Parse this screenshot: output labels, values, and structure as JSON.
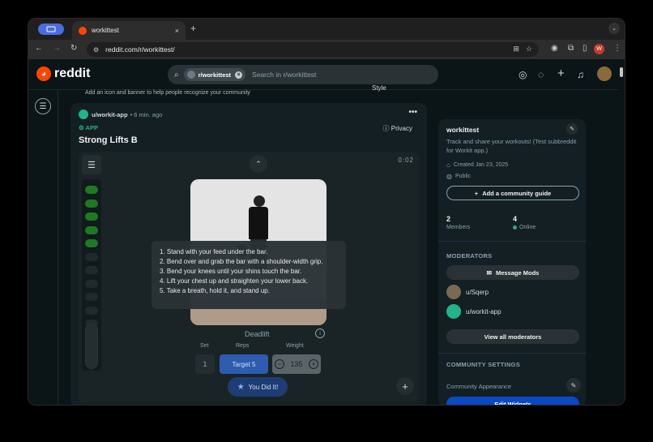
{
  "browser": {
    "tab_title": "workittest",
    "tab_close": "×",
    "new_tab": "+",
    "url": "reddit.com/r/workittest/",
    "profile_initial": "W"
  },
  "header": {
    "logo_text": "reddit",
    "search_chip": "r/workittest",
    "search_placeholder": "Search in r/workittest"
  },
  "banner_hint": "Add an icon and banner to help people recognize your community",
  "style_label": "Style",
  "post": {
    "author": "u/workit-app",
    "time": "• 6 min. ago",
    "more": "•••",
    "app_tag": "APP",
    "privacy": "Privacy",
    "title": "Strong Lifts B"
  },
  "app": {
    "timer": "0:02",
    "instructions": [
      "1. Stand with your feed under the bar.",
      "2. Bend over and grab the bar with a shoulder-width grip.",
      "3. Bend your knees until your shins touch the bar.",
      "4. Lift your chest up and straighten your lower back.",
      "5. Take a breath, hold it, and stand up."
    ],
    "exercise_name": "Deadlift",
    "labels": {
      "set": "Set",
      "reps": "Reps",
      "weight": "Weight"
    },
    "set_value": "1",
    "reps_value": "Target 5",
    "weight_value": "135",
    "done_label": "You Did It!",
    "completed_sets": 5,
    "total_sets": 11,
    "colors": {
      "done": "#1e7a22",
      "pending": "#1f2a2d",
      "accent": "#2e5cae"
    }
  },
  "sidebar": {
    "community_name": "workittest",
    "description": "Track and share your workouts! (Test subbreddit for Workit app.)",
    "created": "Created Jan 23, 2025",
    "visibility": "Public",
    "guide_button": "Add a community guide",
    "members_count": "2",
    "members_label": "Members",
    "online_count": "4",
    "online_label": "Online",
    "moderators_heading": "MODERATORS",
    "message_mods": "Message Mods",
    "moderators": [
      {
        "name": "u/Sqerp",
        "color": "#7a6a55"
      },
      {
        "name": "u/workit-app",
        "color": "#21b38a"
      }
    ],
    "view_all_mods": "View all moderators",
    "settings_heading": "COMMUNITY SETTINGS",
    "appearance_label": "Community Appearance",
    "edit_widgets": "Edit Widgets"
  }
}
